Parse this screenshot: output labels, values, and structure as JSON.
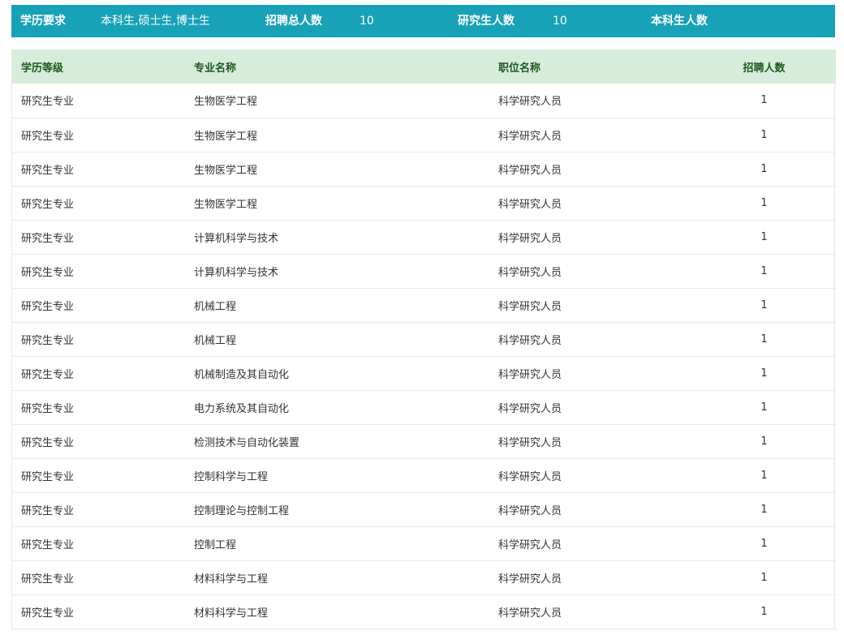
{
  "summary": {
    "education_label": "学历要求",
    "education_value": "本科生,硕士生,博士生",
    "total_label": "招聘总人数",
    "total_value": "10",
    "grad_label": "研究生人数",
    "grad_value": "10",
    "undergrad_label": "本科生人数"
  },
  "table": {
    "headers": [
      "学历等级",
      "专业名称",
      "职位名称",
      "招聘人数"
    ],
    "rows": [
      [
        "研究生专业",
        "生物医学工程",
        "科学研究人员",
        "1"
      ],
      [
        "研究生专业",
        "生物医学工程",
        "科学研究人员",
        "1"
      ],
      [
        "研究生专业",
        "生物医学工程",
        "科学研究人员",
        "1"
      ],
      [
        "研究生专业",
        "生物医学工程",
        "科学研究人员",
        "1"
      ],
      [
        "研究生专业",
        "计算机科学与技术",
        "科学研究人员",
        "1"
      ],
      [
        "研究生专业",
        "计算机科学与技术",
        "科学研究人员",
        "1"
      ],
      [
        "研究生专业",
        "机械工程",
        "科学研究人员",
        "1"
      ],
      [
        "研究生专业",
        "机械工程",
        "科学研究人员",
        "1"
      ],
      [
        "研究生专业",
        "机械制造及其自动化",
        "科学研究人员",
        "1"
      ],
      [
        "研究生专业",
        "电力系统及其自动化",
        "科学研究人员",
        "1"
      ],
      [
        "研究生专业",
        "检测技术与自动化装置",
        "科学研究人员",
        "1"
      ],
      [
        "研究生专业",
        "控制科学与工程",
        "科学研究人员",
        "1"
      ],
      [
        "研究生专业",
        "控制理论与控制工程",
        "科学研究人员",
        "1"
      ],
      [
        "研究生专业",
        "控制工程",
        "科学研究人员",
        "1"
      ],
      [
        "研究生专业",
        "材料科学与工程",
        "科学研究人员",
        "1"
      ],
      [
        "研究生专业",
        "材料科学与工程",
        "科学研究人员",
        "1"
      ]
    ]
  },
  "colors": {
    "summary_bg": "#17a2b8",
    "header_bg": "#d6eddc",
    "header_text": "#1e5a1e",
    "row_border": "#dff0e6"
  }
}
